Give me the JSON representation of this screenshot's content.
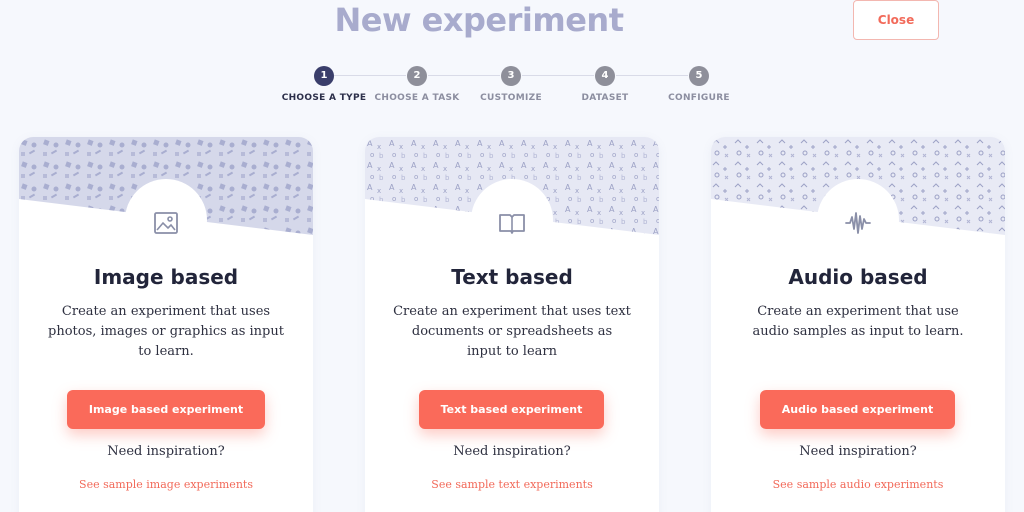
{
  "header": {
    "title": "New experiment",
    "close_label": "Close"
  },
  "stepper": {
    "active_index": 0,
    "steps": [
      {
        "number": "1",
        "label": "CHOOSE A TYPE"
      },
      {
        "number": "2",
        "label": "CHOOSE A TASK"
      },
      {
        "number": "3",
        "label": "CUSTOMIZE"
      },
      {
        "number": "4",
        "label": "DATASET"
      },
      {
        "number": "5",
        "label": "CONFIGURE"
      }
    ]
  },
  "cards": [
    {
      "icon": "image-icon",
      "title": "Image based",
      "description": "Create an experiment that uses photos, images or graphics as input to learn.",
      "button_label": "Image based experiment",
      "inspiration": "Need inspiration?",
      "sample_link": "See sample image experiments"
    },
    {
      "icon": "book-icon",
      "title": "Text based",
      "description": "Create an experiment that uses text documents or spreadsheets as input to learn",
      "button_label": "Text based experiment",
      "inspiration": "Need inspiration?",
      "sample_link": "See sample text experiments"
    },
    {
      "icon": "audio-wave-icon",
      "title": "Audio based",
      "description": "Create an experiment that use audio samples as input to learn.",
      "button_label": "Audio based experiment",
      "inspiration": "Need inspiration?",
      "sample_link": "See sample audio experiments"
    }
  ],
  "colors": {
    "accent": "#fa6a5a",
    "title": "#a8abcd",
    "active_step": "#3a3e6b",
    "inactive_step": "#8e8f9a"
  }
}
